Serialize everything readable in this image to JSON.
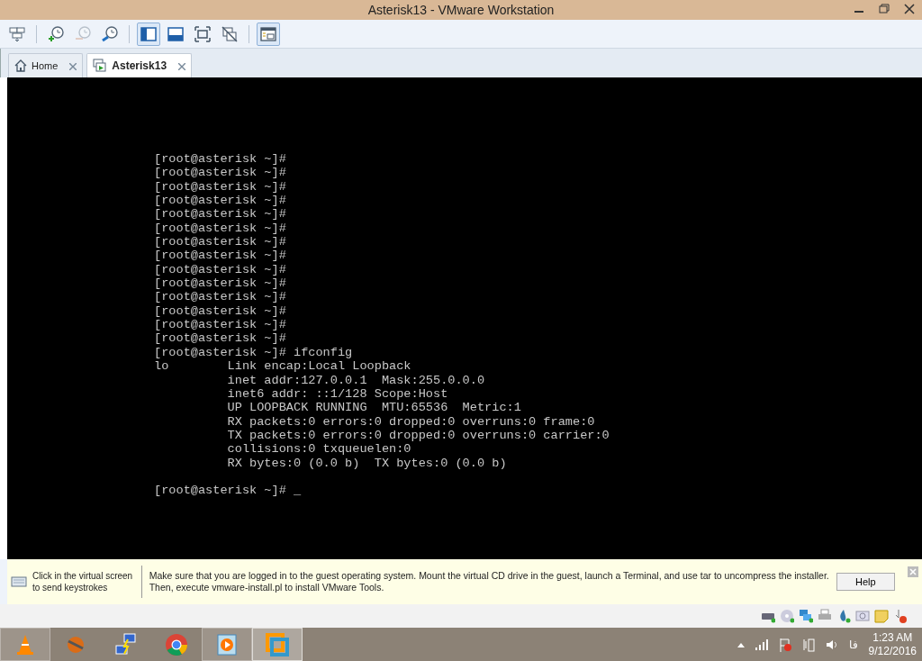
{
  "window": {
    "title": "Asterisk13 - VMware Workstation"
  },
  "toolbar": [
    {
      "kind": "send-keys",
      "pressed": false,
      "disabled": false
    },
    {
      "kind": "snapshot-take",
      "pressed": false,
      "disabled": false
    },
    {
      "kind": "snapshot-revert",
      "pressed": false,
      "disabled": true
    },
    {
      "kind": "snapshot-manager",
      "pressed": false,
      "disabled": false
    },
    {
      "kind": "console-view",
      "pressed": true,
      "disabled": false
    },
    {
      "kind": "thumbnail-bar",
      "pressed": false,
      "disabled": false
    },
    {
      "kind": "full-screen",
      "pressed": false,
      "disabled": false
    },
    {
      "kind": "unity",
      "pressed": false,
      "disabled": false
    },
    {
      "kind": "library",
      "pressed": true,
      "disabled": false
    }
  ],
  "tabs": [
    {
      "label": "Home",
      "kind": "home",
      "selected": false
    },
    {
      "label": "Asterisk13",
      "kind": "vm",
      "selected": true
    }
  ],
  "terminal": {
    "lines": [
      "[root@asterisk ~]#",
      "[root@asterisk ~]#",
      "[root@asterisk ~]#",
      "[root@asterisk ~]#",
      "[root@asterisk ~]#",
      "[root@asterisk ~]#",
      "[root@asterisk ~]#",
      "[root@asterisk ~]#",
      "[root@asterisk ~]#",
      "[root@asterisk ~]#",
      "[root@asterisk ~]#",
      "[root@asterisk ~]#",
      "[root@asterisk ~]#",
      "[root@asterisk ~]#",
      "[root@asterisk ~]# ifconfig",
      "lo        Link encap:Local Loopback",
      "          inet addr:127.0.0.1  Mask:255.0.0.0",
      "          inet6 addr: ::1/128 Scope:Host",
      "          UP LOOPBACK RUNNING  MTU:65536  Metric:1",
      "          RX packets:0 errors:0 dropped:0 overruns:0 frame:0",
      "          TX packets:0 errors:0 dropped:0 overruns:0 carrier:0",
      "          collisions:0 txqueuelen:0",
      "          RX bytes:0 (0.0 b)  TX bytes:0 (0.0 b)"
    ],
    "prompt": "[root@asterisk ~]# _"
  },
  "hint_bar": {
    "keystroke_lines": [
      "Click in the virtual screen",
      "to send keystrokes"
    ],
    "message_lines": [
      "Make sure that you are logged in to the guest operating system. Mount the virtual CD drive in the guest, launch a Terminal, and use tar to uncompress the installer.",
      "Then, execute vmware-install.pl to install VMware Tools."
    ],
    "button": "Help"
  },
  "taskbar": {
    "apps": [
      {
        "kind": "vlc",
        "running": true,
        "active": false
      },
      {
        "kind": "ftp",
        "running": false,
        "active": false
      },
      {
        "kind": "network",
        "running": false,
        "active": false
      },
      {
        "kind": "chrome",
        "running": false,
        "active": false
      },
      {
        "kind": "media",
        "running": true,
        "active": false
      },
      {
        "kind": "vmware",
        "running": true,
        "active": true
      }
    ],
    "language": "فا",
    "time": "1:23 AM",
    "date": "9/12/2016"
  }
}
